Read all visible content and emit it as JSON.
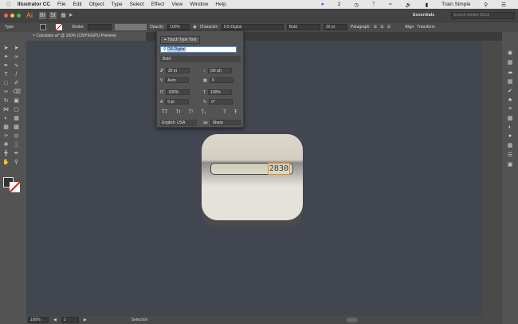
{
  "menubar": {
    "items": [
      "Illustrator CC",
      "File",
      "Edit",
      "Object",
      "Type",
      "Select",
      "Effect",
      "View",
      "Window",
      "Help"
    ],
    "notif_count": "2",
    "user": "Train Simple"
  },
  "appbar": {
    "logo": "Ai",
    "workspace": "Essentials",
    "search_placeholder": "Search Adobe Stock"
  },
  "control": {
    "tool": "Type",
    "stroke_label": "Stroke:",
    "opacity_label": "Opacity:",
    "opacity": "100%",
    "character_label": "Character:",
    "font": "DS-Digital",
    "style": "Bold",
    "size": "30 pt",
    "paragraph_label": "Paragraph:",
    "align_label": "Align",
    "transform_label": "Transform"
  },
  "document": {
    "tab": "Calculator.ai* @ 100% (CMYK/GPU Preview)"
  },
  "character_panel": {
    "touch_type": "Touch Type Tool",
    "font": "DS-Digital",
    "style": "Bold",
    "size": "30 pt",
    "leading": "(36 pt)",
    "kerning": "Auto",
    "tracking": "0",
    "vscale": "100%",
    "hscale": "100%",
    "baseline": "0 pt",
    "rotation": "0°",
    "language": "English: USA",
    "antialias": "Sharp"
  },
  "artwork": {
    "display": "2830"
  },
  "status": {
    "zoom": "100%",
    "page": "1",
    "tool": "Selection"
  },
  "colors": {
    "accent": "#f08a24",
    "canvas": "#414650"
  }
}
